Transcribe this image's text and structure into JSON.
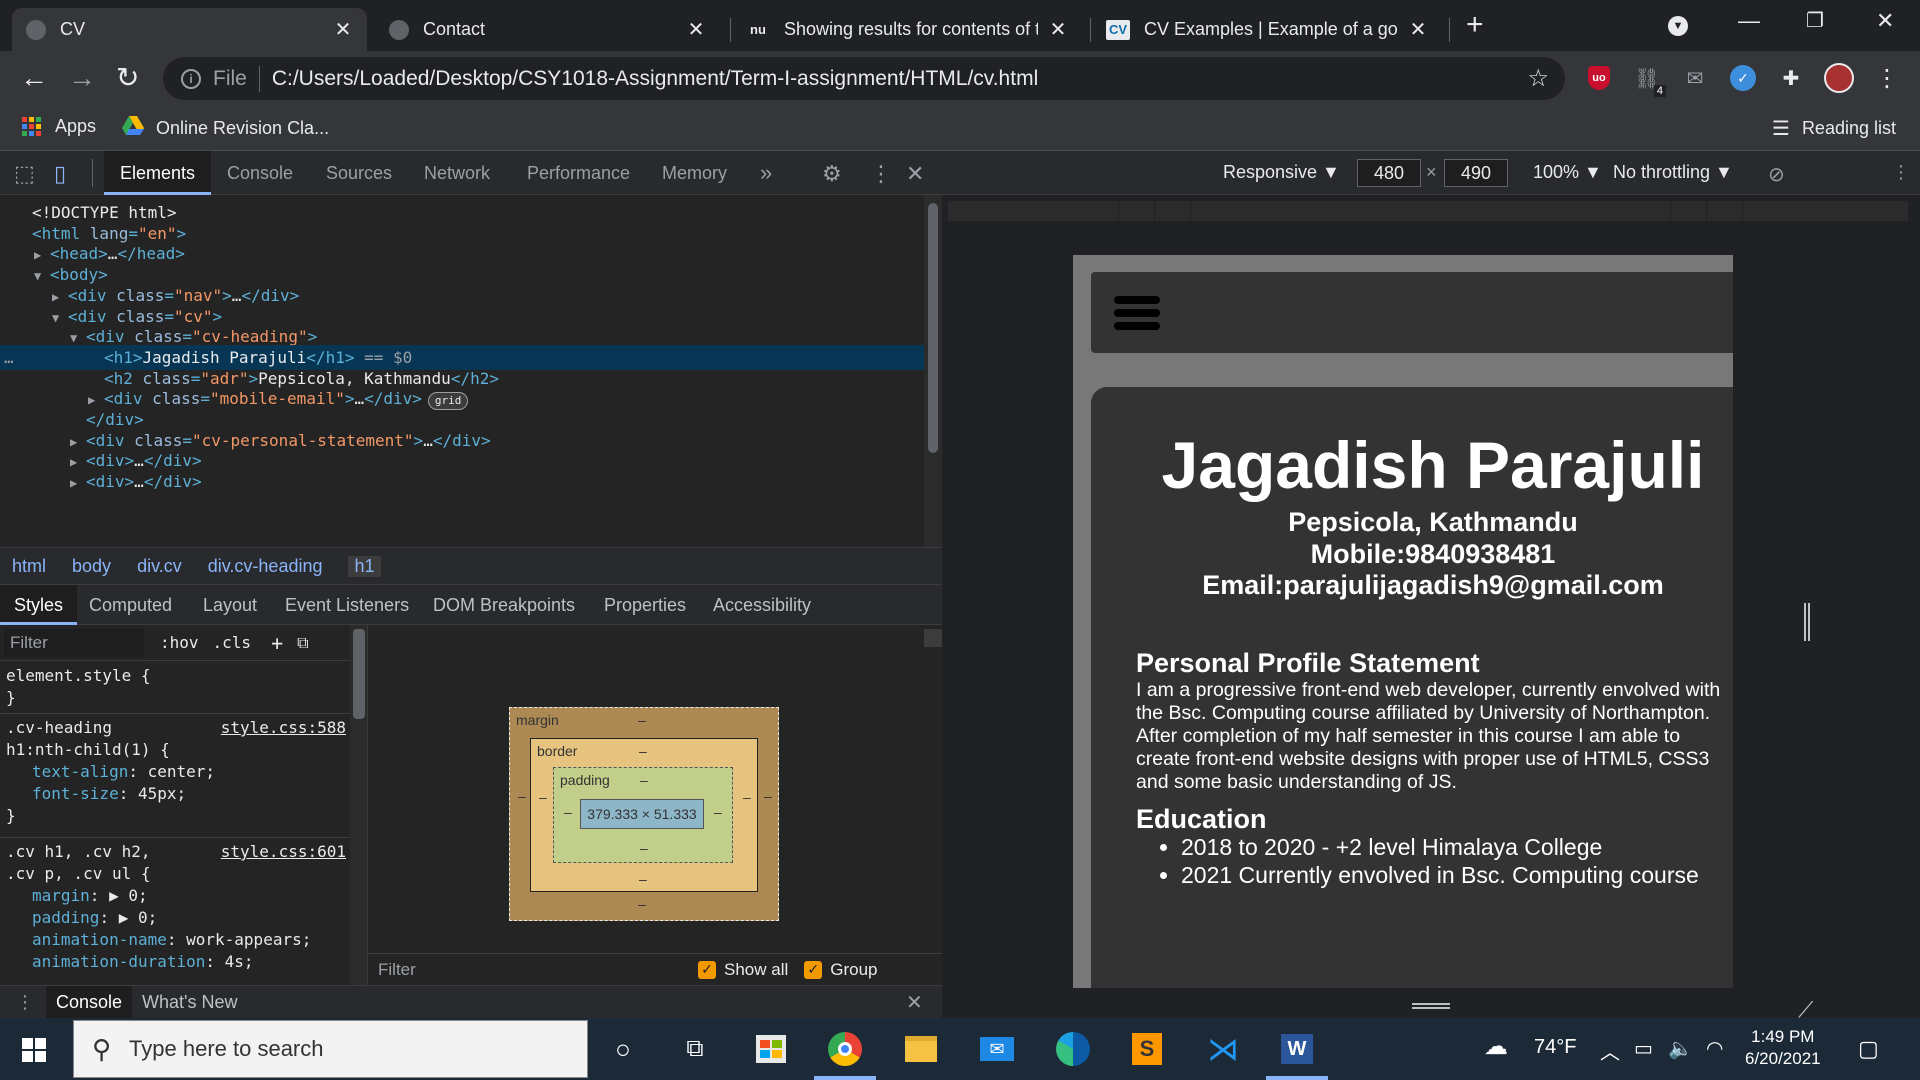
{
  "browser": {
    "tabs": [
      {
        "title": "CV",
        "active": true
      },
      {
        "title": "Contact",
        "active": false
      },
      {
        "title": "Showing results for contents of t",
        "active": false
      },
      {
        "title": "CV Examples | Example of a gooc",
        "active": false
      }
    ],
    "tab_favicon_texts": {
      "tab3": "nu",
      "tab4": "CV"
    },
    "address": {
      "scheme": "File",
      "url": "C:/Users/Loaded/Desktop/CSY1018-Assignment/Term-I-assignment/HTML/cv.html"
    },
    "extension_badge": "4",
    "bookmarks": [
      {
        "label": "Apps",
        "icon": "apps-grid-icon"
      },
      {
        "label": "Online Revision Cla...",
        "icon": "google-drive-icon"
      }
    ],
    "reading_list": "Reading list"
  },
  "devtools": {
    "tabs": [
      "Elements",
      "Console",
      "Sources",
      "Network",
      "Performance",
      "Memory"
    ],
    "more_tabs": "»",
    "dom_lines": [
      {
        "indent": 0,
        "tri": "",
        "parts": [
          [
            "txt",
            "<!DOCTYPE html>"
          ]
        ]
      },
      {
        "indent": 0,
        "tri": "",
        "parts": [
          [
            "tag",
            "<html "
          ],
          [
            "attr",
            "lang"
          ],
          [
            "tag",
            "="
          ],
          [
            "aval",
            "\"en\""
          ],
          [
            "tag",
            ">"
          ]
        ]
      },
      {
        "indent": 1,
        "tri": "▶",
        "parts": [
          [
            "tag",
            "<head>"
          ],
          [
            "txt",
            "…"
          ],
          [
            "tag",
            "</head>"
          ]
        ]
      },
      {
        "indent": 1,
        "tri": "▼",
        "parts": [
          [
            "tag",
            "<body>"
          ]
        ]
      },
      {
        "indent": 2,
        "tri": "▶",
        "parts": [
          [
            "tag",
            "<div "
          ],
          [
            "attr",
            "class"
          ],
          [
            "tag",
            "="
          ],
          [
            "aval",
            "\"nav\""
          ],
          [
            "tag",
            ">"
          ],
          [
            "txt",
            "…"
          ],
          [
            "tag",
            "</div>"
          ]
        ]
      },
      {
        "indent": 2,
        "tri": "▼",
        "parts": [
          [
            "tag",
            "<div "
          ],
          [
            "attr",
            "class"
          ],
          [
            "tag",
            "="
          ],
          [
            "aval",
            "\"cv\""
          ],
          [
            "tag",
            ">"
          ]
        ]
      },
      {
        "indent": 3,
        "tri": "▼",
        "parts": [
          [
            "tag",
            "<div "
          ],
          [
            "attr",
            "class"
          ],
          [
            "tag",
            "="
          ],
          [
            "aval",
            "\"cv-heading\""
          ],
          [
            "tag",
            ">"
          ]
        ]
      },
      {
        "indent": 4,
        "tri": "",
        "selected": true,
        "parts": [
          [
            "tag",
            "<h1>"
          ],
          [
            "txt",
            "Jagadish Parajuli"
          ],
          [
            "tag",
            "</h1>"
          ],
          [
            "dim",
            " == $0"
          ]
        ]
      },
      {
        "indent": 4,
        "tri": "",
        "parts": [
          [
            "tag",
            "<h2 "
          ],
          [
            "attr",
            "class"
          ],
          [
            "tag",
            "="
          ],
          [
            "aval",
            "\"adr\""
          ],
          [
            "tag",
            ">"
          ],
          [
            "txt",
            "Pepsicola, Kathmandu"
          ],
          [
            "tag",
            "</h2>"
          ]
        ]
      },
      {
        "indent": 4,
        "tri": "▶",
        "badge": "grid",
        "parts": [
          [
            "tag",
            "<div "
          ],
          [
            "attr",
            "class"
          ],
          [
            "tag",
            "="
          ],
          [
            "aval",
            "\"mobile-email\""
          ],
          [
            "tag",
            ">"
          ],
          [
            "txt",
            "…"
          ],
          [
            "tag",
            "</div>"
          ]
        ]
      },
      {
        "indent": 3,
        "tri": "",
        "parts": [
          [
            "tag",
            "</div>"
          ]
        ]
      },
      {
        "indent": 3,
        "tri": "▶",
        "parts": [
          [
            "tag",
            "<div "
          ],
          [
            "attr",
            "class"
          ],
          [
            "tag",
            "="
          ],
          [
            "aval",
            "\"cv-personal-statement\""
          ],
          [
            "tag",
            ">"
          ],
          [
            "txt",
            "…"
          ],
          [
            "tag",
            "</div>"
          ]
        ]
      },
      {
        "indent": 3,
        "tri": "▶",
        "parts": [
          [
            "tag",
            "<div>"
          ],
          [
            "txt",
            "…"
          ],
          [
            "tag",
            "</div>"
          ]
        ]
      },
      {
        "indent": 3,
        "tri": "▶",
        "parts": [
          [
            "tag",
            "<div>"
          ],
          [
            "txt",
            "…"
          ],
          [
            "tag",
            "</div>"
          ]
        ]
      }
    ],
    "breadcrumbs": [
      "html",
      "body",
      "div.cv",
      "div.cv-heading",
      "h1"
    ],
    "sub_tabs": [
      "Styles",
      "Computed",
      "Layout",
      "Event Listeners",
      "DOM Breakpoints",
      "Properties",
      "Accessibility"
    ],
    "styles": {
      "filter_placeholder": "Filter",
      "hov": ":hov",
      "cls": ".cls",
      "rule1": {
        "selector": "element.style {",
        "close": "}"
      },
      "rule2": {
        "selector1": ".cv-heading",
        "selector2": "h1:nth-child(1) {",
        "source": "style.css:588",
        "props": [
          [
            "text-align",
            "center;"
          ],
          [
            "font-size",
            "45px;"
          ]
        ],
        "close": "}"
      },
      "rule3": {
        "selector1": ".cv h1, .cv h2,",
        "selector2": ".cv p, .cv ul {",
        "source": "style.css:601",
        "props": [
          [
            "margin",
            "▶ 0;"
          ],
          [
            "padding",
            "▶ 0;"
          ],
          [
            "animation-name",
            "work-appears;"
          ],
          [
            "animation-duration",
            "4s;"
          ]
        ]
      }
    },
    "box_model": {
      "margin_label": "margin",
      "border_label": "border",
      "padding_label": "padding",
      "dash": "–",
      "content_size": "379.333 × 51.333"
    },
    "computed_filter": {
      "placeholder": "Filter",
      "show_all": "Show all",
      "group": "Group"
    },
    "drawer_tabs": [
      "Console",
      "What's New"
    ]
  },
  "device_toolbar": {
    "device": "Responsive ▼",
    "width": "480",
    "height": "490",
    "times": "×",
    "zoom": "100% ▼",
    "throttling": "No throttling ▼"
  },
  "cv": {
    "name": "Jagadish Parajuli",
    "address": "Pepsicola, Kathmandu",
    "mobile": "Mobile:9840938481",
    "email": "Email:parajulijagadish9@gmail.com",
    "statement_heading": "Personal Profile Statement",
    "statement_lines": [
      "I am a progressive front-end web developer, currently envolved with",
      "the Bsc. Computing course affiliated by University of Northampton.",
      "After completion of my half semester in this course I am able to",
      "create front-end website designs with proper use of HTML5, CSS3",
      "and some basic understanding of JS."
    ],
    "education_heading": "Education",
    "education_items": [
      "2018 to 2020 - +2 level Himalaya College",
      "2021 Currently envolved in Bsc. Computing course"
    ]
  },
  "taskbar": {
    "search_placeholder": "Type here to search",
    "weather": "74°F",
    "time": "1:49 PM",
    "date": "6/20/2021"
  }
}
